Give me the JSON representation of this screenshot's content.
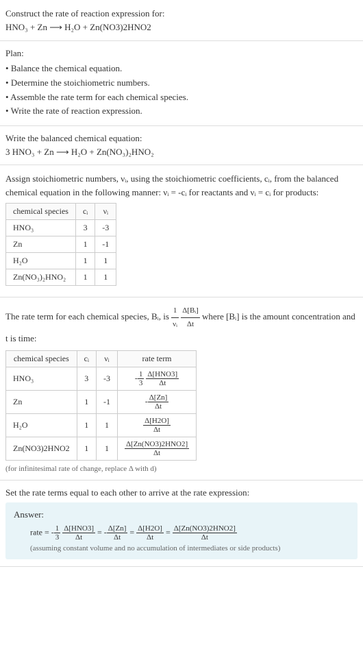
{
  "question": {
    "prompt": "Construct the rate of reaction expression for:",
    "equation": "HNO₃ + Zn ⟶ H₂O + Zn(NO3)2HNO2"
  },
  "plan": {
    "title": "Plan:",
    "items": [
      "Balance the chemical equation.",
      "Determine the stoichiometric numbers.",
      "Assemble the rate term for each chemical species.",
      "Write the rate of reaction expression."
    ]
  },
  "balanced": {
    "title": "Write the balanced chemical equation:",
    "equation": "3 HNO₃ + Zn ⟶ H₂O + Zn(NO₃)₂HNO₂"
  },
  "stoich": {
    "intro_a": "Assign stoichiometric numbers, νᵢ, using the stoichiometric coefficients, cᵢ, from the balanced chemical equation in the following manner: νᵢ = -cᵢ for reactants and νᵢ = cᵢ for products:",
    "headers": [
      "chemical species",
      "cᵢ",
      "νᵢ"
    ],
    "rows": [
      {
        "sp": "HNO₃",
        "c": "3",
        "v": "-3"
      },
      {
        "sp": "Zn",
        "c": "1",
        "v": "-1"
      },
      {
        "sp": "H₂O",
        "c": "1",
        "v": "1"
      },
      {
        "sp": "Zn(NO₃)₂HNO₂",
        "c": "1",
        "v": "1"
      }
    ]
  },
  "rateterm": {
    "intro_a": "The rate term for each chemical species, Bᵢ, is ",
    "intro_b": " where [Bᵢ] is the amount concentration and t is time:",
    "headers": [
      "chemical species",
      "cᵢ",
      "νᵢ",
      "rate term"
    ],
    "rows": [
      {
        "sp": "HNO₃",
        "c": "3",
        "v": "-3",
        "rn": "Δ[HNO3]",
        "rd": "Δt",
        "pre": "-",
        "coef_n": "1",
        "coef_d": "3"
      },
      {
        "sp": "Zn",
        "c": "1",
        "v": "-1",
        "rn": "Δ[Zn]",
        "rd": "Δt",
        "pre": "-",
        "coef_n": "",
        "coef_d": ""
      },
      {
        "sp": "H₂O",
        "c": "1",
        "v": "1",
        "rn": "Δ[H2O]",
        "rd": "Δt",
        "pre": "",
        "coef_n": "",
        "coef_d": ""
      },
      {
        "sp": "Zn(NO3)2HNO2",
        "c": "1",
        "v": "1",
        "rn": "Δ[Zn(NO3)2HNO2]",
        "rd": "Δt",
        "pre": "",
        "coef_n": "",
        "coef_d": ""
      }
    ],
    "note": "(for infinitesimal rate of change, replace Δ with d)"
  },
  "final": {
    "title": "Set the rate terms equal to each other to arrive at the rate expression:",
    "label": "Answer:",
    "prefix": "rate = ",
    "terms": [
      {
        "pre": "-",
        "cn": "1",
        "cd": "3",
        "n": "Δ[HNO3]",
        "d": "Δt"
      },
      {
        "pre": "-",
        "cn": "",
        "cd": "",
        "n": "Δ[Zn]",
        "d": "Δt"
      },
      {
        "pre": "",
        "cn": "",
        "cd": "",
        "n": "Δ[H2O]",
        "d": "Δt"
      },
      {
        "pre": "",
        "cn": "",
        "cd": "",
        "n": "Δ[Zn(NO3)2HNO2]",
        "d": "Δt"
      }
    ],
    "assume": "(assuming constant volume and no accumulation of intermediates or side products)"
  }
}
